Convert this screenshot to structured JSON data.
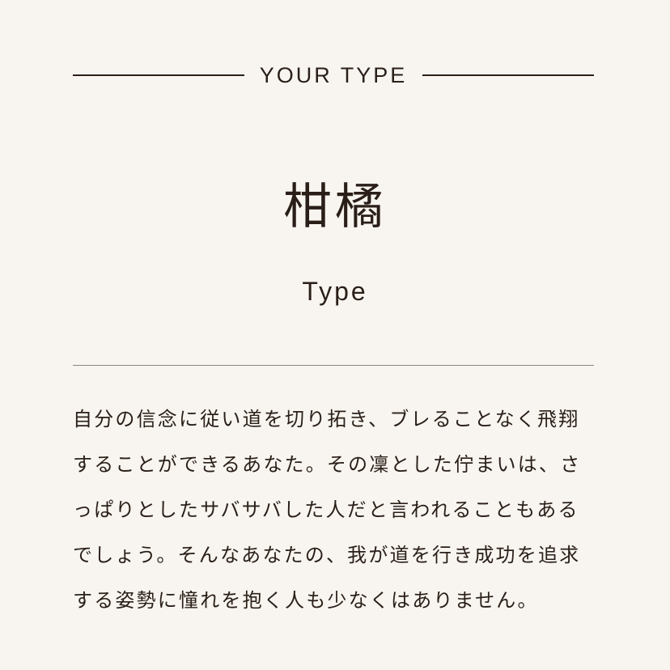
{
  "header": {
    "eyebrow": "YOUR TYPE"
  },
  "result": {
    "type_name": "柑橘",
    "type_subtitle": "Type"
  },
  "description": "自分の信念に従い道を切り拓き、ブレることなく飛翔することができるあなた。その凜とした佇まいは、さっぱりとしたサバサバした人だと言われることもあるでしょう。そんなあなたの、我が道を行き成功を追求する姿勢に憧れを抱く人も少なくはありません。",
  "colors": {
    "background": "#f8f5f0",
    "text": "#2a1f18",
    "divider": "#8a837c"
  }
}
